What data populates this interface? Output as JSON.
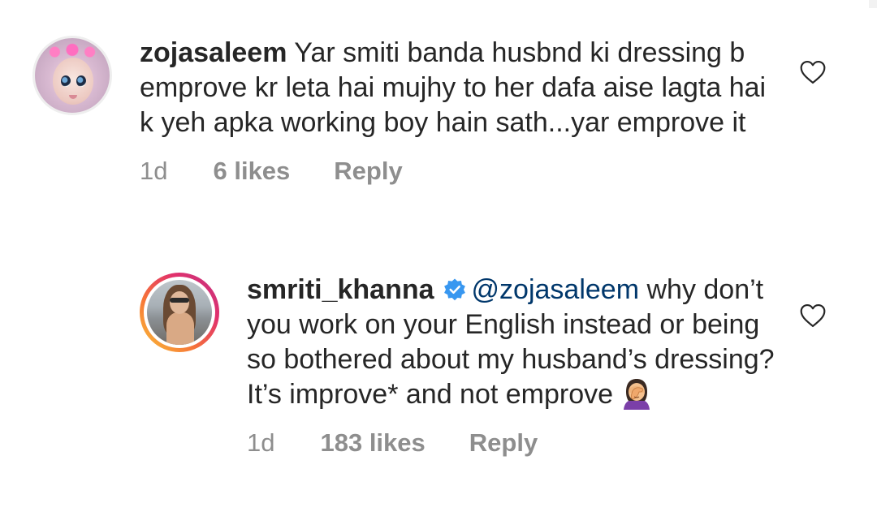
{
  "comments": [
    {
      "username": "zojasaleem",
      "text": "Yar smiti banda husbnd ki dressing b emprove kr leta hai mujhy to her dafa aise lagta hai k yeh apka working boy hain sath...yar emprove it",
      "time": "1d",
      "likes": "6 likes",
      "reply": "Reply"
    }
  ],
  "reply_comment": {
    "username": "smriti_khanna",
    "verified": true,
    "mention": "@zojasaleem",
    "text": "why don’t you work on your English instead or being so bothered about my husband’s dressing? It’s improve* and not emprove",
    "emoji": "person-facepalming-emoji",
    "time": "1d",
    "likes": "183 likes",
    "reply": "Reply"
  },
  "colors": {
    "text": "#262626",
    "secondary": "#8e8e8e",
    "mention": "#00376b",
    "verified": "#3897f0"
  },
  "icons": [
    "heart-outline-icon",
    "verified-badge-icon"
  ]
}
